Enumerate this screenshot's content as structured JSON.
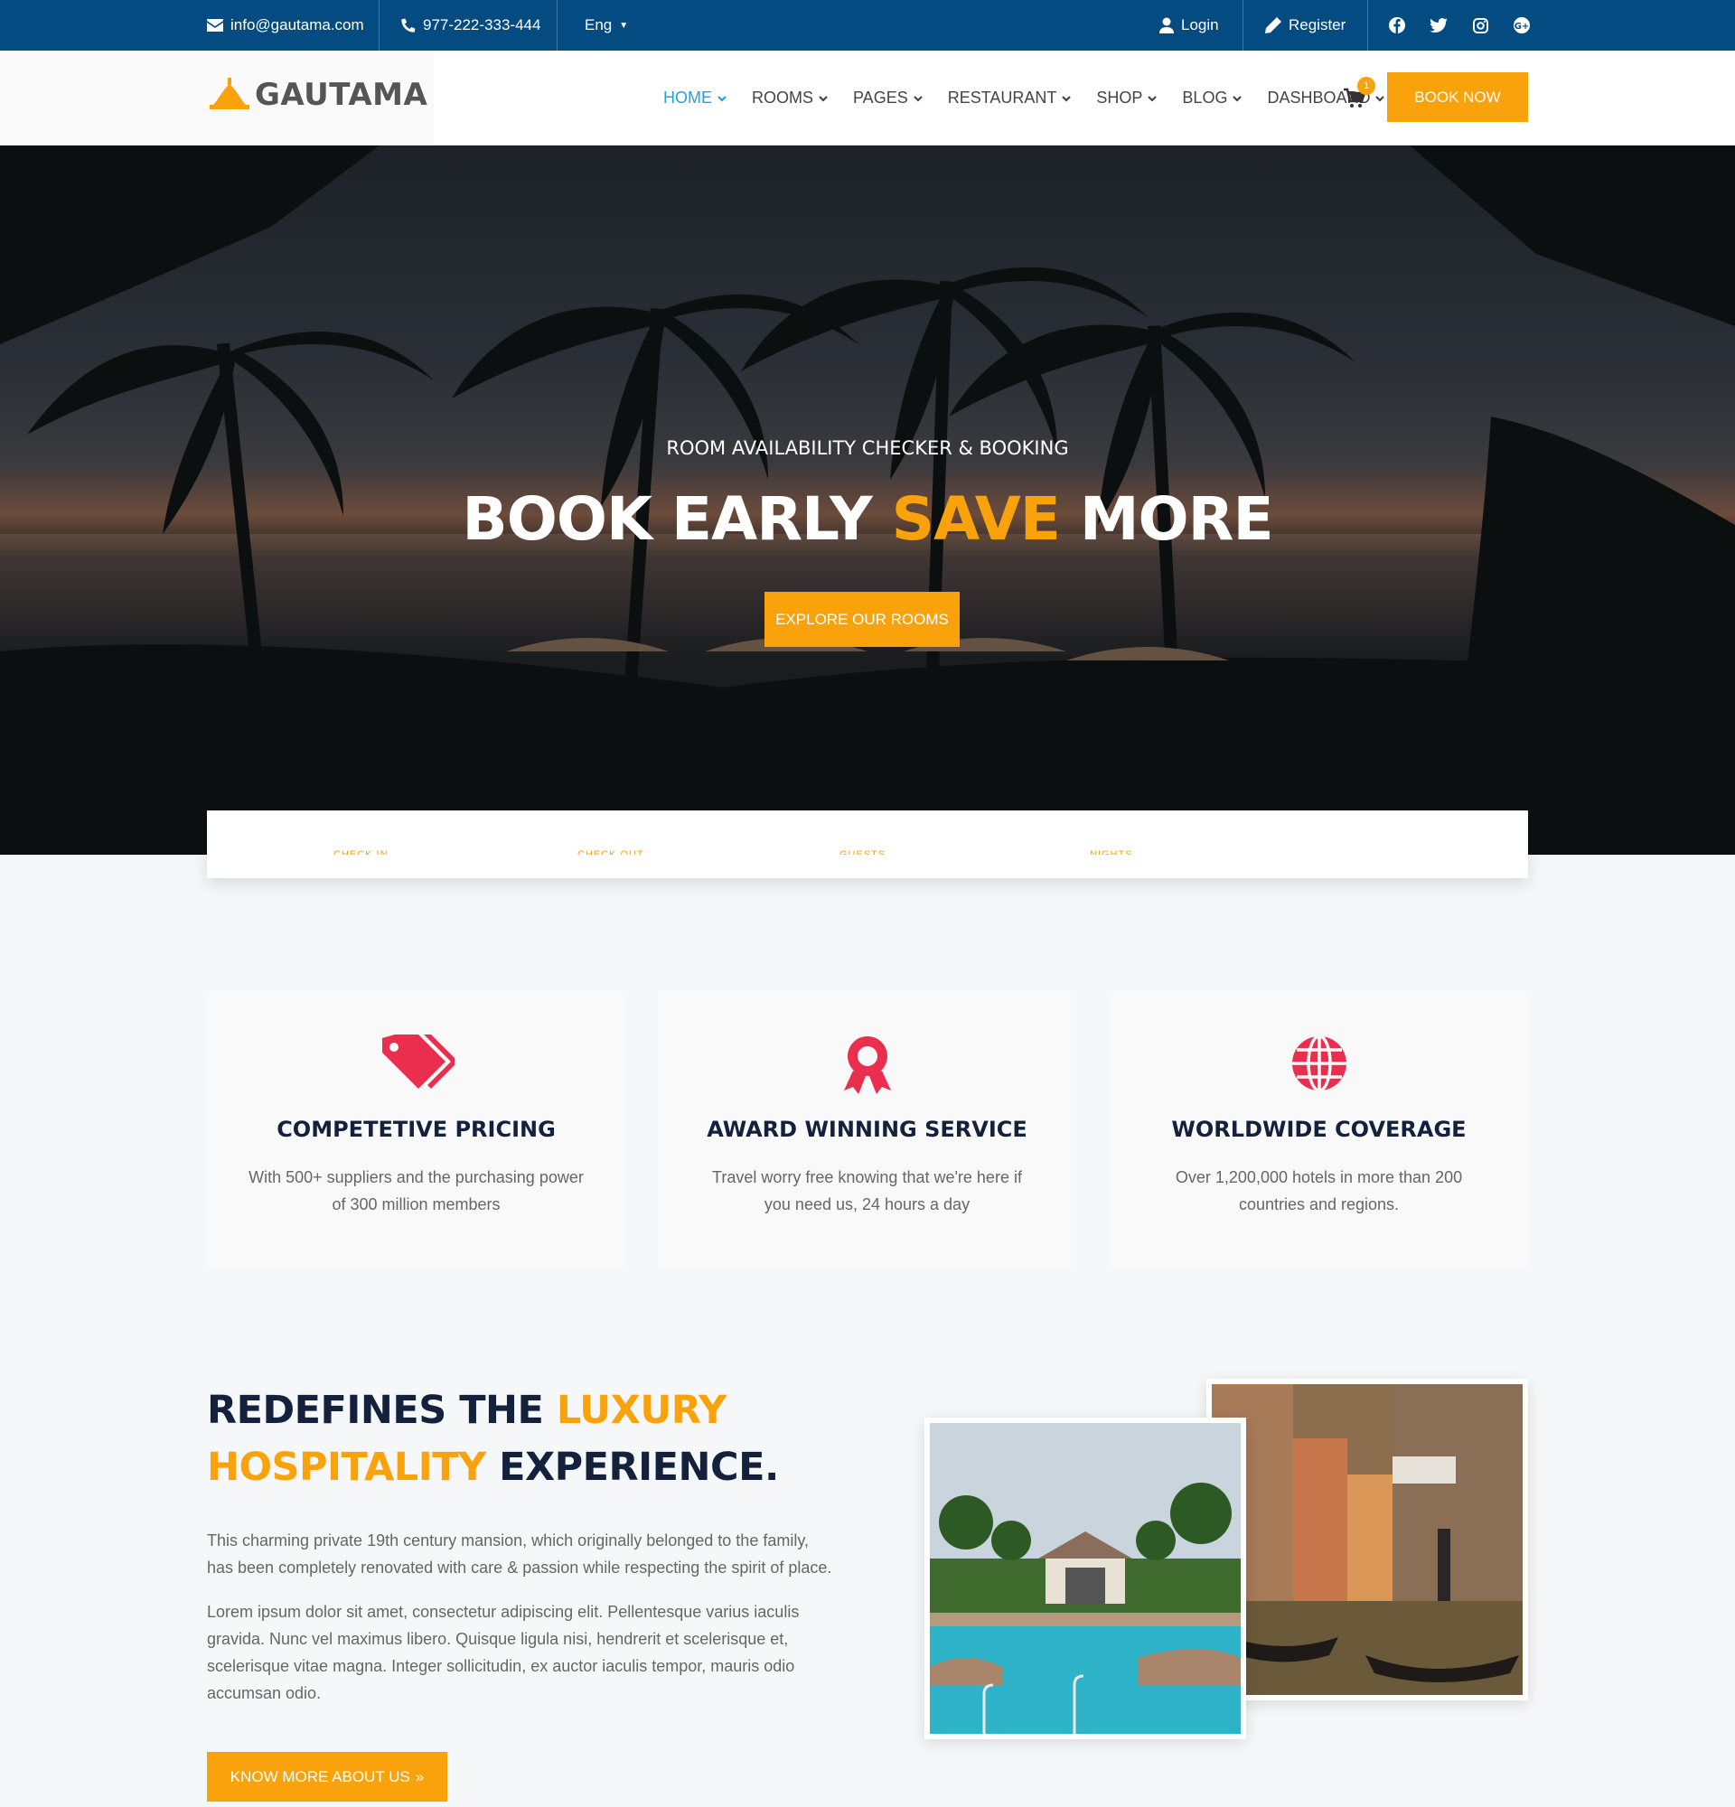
{
  "topbar": {
    "email": "info@gautama.com",
    "phone": "977-222-333-444",
    "language": "Eng",
    "login": "Login",
    "register": "Register",
    "social_icons": [
      "facebook-icon",
      "twitter-icon",
      "instagram-icon",
      "google-plus-icon"
    ]
  },
  "brand": {
    "name": "GAUTAMA",
    "accent_color": "#f9a20b",
    "topbar_color": "#044b82"
  },
  "nav": {
    "items": [
      {
        "label": "HOME",
        "active": true
      },
      {
        "label": "ROOMS"
      },
      {
        "label": "PAGES"
      },
      {
        "label": "RESTAURANT"
      },
      {
        "label": "SHOP"
      },
      {
        "label": "BLOG"
      },
      {
        "label": "DASHBOARD"
      }
    ],
    "cart_count": "1",
    "book_now": "BOOK NOW"
  },
  "hero": {
    "subtitle": "ROOM AVAILABILITY CHECKER & BOOKING",
    "title_part1": "BOOK EARLY ",
    "title_accent": "SAVE",
    "title_part2": " MORE",
    "button": "EXPLORE OUR ROOMS"
  },
  "booking": {
    "labels": [
      "CHECK IN",
      "CHECK OUT",
      "GUESTS",
      "NIGHTS"
    ]
  },
  "features": [
    {
      "icon": "tags-icon",
      "title": "COMPETETIVE PRICING",
      "text": "With 500+ suppliers and the purchasing power of 300 million members"
    },
    {
      "icon": "award-icon",
      "title": "AWARD WINNING SERVICE",
      "text": "Travel worry free knowing that we're here if you need us, 24 hours a day"
    },
    {
      "icon": "globe-icon",
      "title": "WORLDWIDE COVERAGE",
      "text": "Over 1,200,000 hotels in more than 200 countries and regions."
    }
  ],
  "about": {
    "heading_part1": "REDEFINES THE ",
    "heading_accent1": "LUXURY",
    "heading_accent2": "HOSPITALITY",
    "heading_part2": " EXPERIENCE.",
    "para1": "This charming private 19th century mansion, which originally belonged to the family, has been completely renovated with care & passion while respecting the spirit of place.",
    "para2": "Lorem ipsum dolor sit amet, consectetur adipiscing elit. Pellentesque varius iaculis gravida. Nunc vel maximus libero. Quisque ligula nisi, hendrerit et scelerisque et, scelerisque vitae magna. Integer sollicitudin, ex auctor iaculis tempor, mauris odio accumsan odio.",
    "button": "KNOW MORE ABOUT US"
  }
}
